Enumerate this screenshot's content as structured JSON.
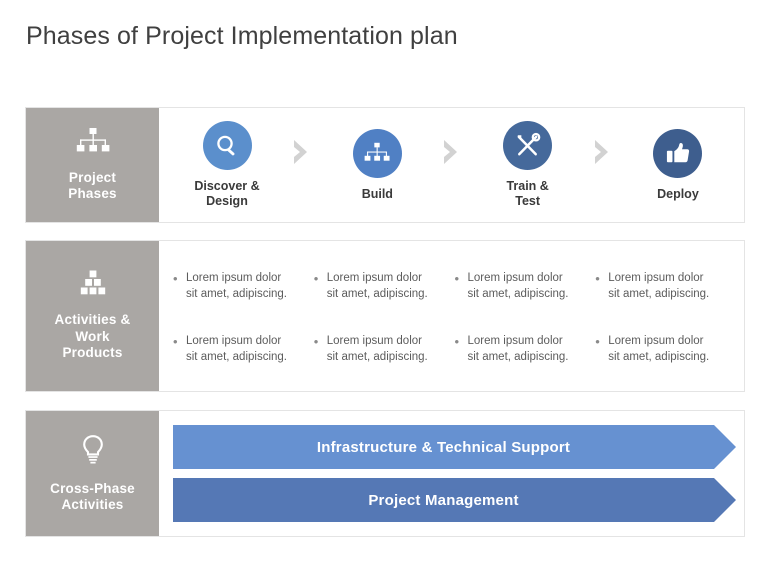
{
  "slide": {
    "title": "Phases of Project Implementation plan"
  },
  "colors": {
    "label_gray": "#aaa7a4",
    "panel_border": "#e4e4e4",
    "chevron_gray": "#d2d2d2",
    "title_text": "#404040",
    "phase_text": "#3a3a3a",
    "bullet_text": "#5c5c5c",
    "bar_light_blue": "#6691d1",
    "bar_dark_blue": "#5578b5"
  },
  "rows": {
    "phases": {
      "label": "Project\nPhases",
      "icon": "org-chart-icon",
      "items": [
        {
          "name": "Discover &\nDesign",
          "icon": "magnifier-icon",
          "color": "#5b8fcc"
        },
        {
          "name": "Build",
          "icon": "org-chart-icon",
          "color": "#5080c4"
        },
        {
          "name": "Train &\nTest",
          "icon": "tools-icon",
          "color": "#45699b"
        },
        {
          "name": "Deploy",
          "icon": "thumbs-up-icon",
          "color": "#3e5e8e"
        }
      ],
      "separator_icon": "chevron-right-icon"
    },
    "activities": {
      "label": "Activities &\nWork\nProducts",
      "icon": "blocks-pyramid-icon",
      "bullet_symbol": "•",
      "columns": [
        {
          "bullets": [
            "Lorem ipsum dolor sit amet, adipiscing.",
            "Lorem ipsum dolor sit amet, adipiscing."
          ]
        },
        {
          "bullets": [
            "Lorem ipsum dolor sit amet, adipiscing.",
            "Lorem ipsum dolor sit amet, adipiscing."
          ]
        },
        {
          "bullets": [
            "Lorem ipsum dolor sit amet, adipiscing.",
            "Lorem ipsum dolor sit amet, adipiscing."
          ]
        },
        {
          "bullets": [
            "Lorem ipsum dolor sit amet, adipiscing.",
            "Lorem ipsum dolor sit amet, adipiscing."
          ]
        }
      ]
    },
    "cross_phase": {
      "label": "Cross-Phase\nActivities",
      "icon": "lightbulb-icon",
      "bars": [
        {
          "text": "Infrastructure & Technical Support",
          "color": "#6691d1"
        },
        {
          "text": "Project Management",
          "color": "#5578b5"
        }
      ]
    }
  }
}
